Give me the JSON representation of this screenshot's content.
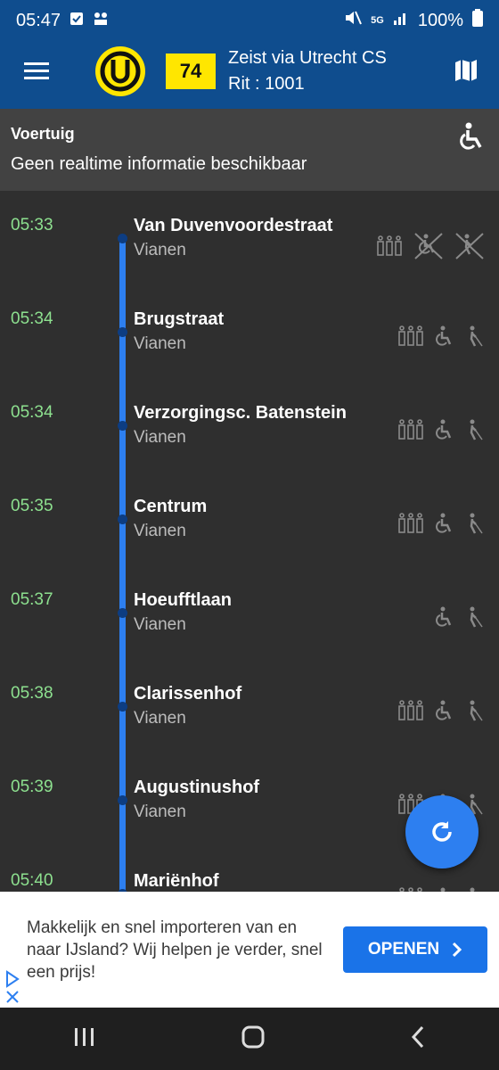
{
  "status_bar": {
    "time": "05:47",
    "battery": "100%",
    "network_label": "5G"
  },
  "app_bar": {
    "line_number": "74",
    "title": "Zeist via Utrecht CS",
    "subtitle": "Rit : 1001"
  },
  "vehicle": {
    "title": "Voertuig",
    "info": "Geen realtime informatie beschikbaar"
  },
  "stops": [
    {
      "time": "05:33",
      "name": "Van Duvenvoordestraat",
      "place": "Vianen",
      "icons": [
        "passengers-icon",
        "wheelchair-crossed-icon",
        "blind-crossed-icon"
      ]
    },
    {
      "time": "05:34",
      "name": "Brugstraat",
      "place": "Vianen",
      "icons": [
        "passengers-icon",
        "wheelchair-icon",
        "blind-icon"
      ]
    },
    {
      "time": "05:34",
      "name": "Verzorgingsc. Batenstein",
      "place": "Vianen",
      "icons": [
        "passengers-icon",
        "wheelchair-icon",
        "blind-icon"
      ]
    },
    {
      "time": "05:35",
      "name": "Centrum",
      "place": "Vianen",
      "icons": [
        "passengers-icon",
        "wheelchair-icon",
        "blind-icon"
      ]
    },
    {
      "time": "05:37",
      "name": "Hoeufftlaan",
      "place": "Vianen",
      "icons": [
        "wheelchair-icon",
        "blind-icon"
      ]
    },
    {
      "time": "05:38",
      "name": "Clarissenhof",
      "place": "Vianen",
      "icons": [
        "passengers-icon",
        "wheelchair-icon",
        "blind-icon"
      ]
    },
    {
      "time": "05:39",
      "name": "Augustinushof",
      "place": "Vianen",
      "icons": [
        "passengers-icon",
        "wheelchair-icon",
        "blind-icon"
      ]
    },
    {
      "time": "05:40",
      "name": "Mariënhof",
      "place": "",
      "icons": [
        "passengers-icon",
        "wheelchair-icon",
        "blind-icon"
      ]
    }
  ],
  "ad": {
    "text": "Makkelijk en snel importeren van en naar IJsland? Wij helpen je verder, snel een prijs!",
    "button_label": "OPENEN"
  },
  "colors": {
    "app_bar": "#0f4d8e",
    "time_green": "#8de08f",
    "line_blue": "#2d7ff0",
    "badge_yellow": "#ffe600"
  }
}
